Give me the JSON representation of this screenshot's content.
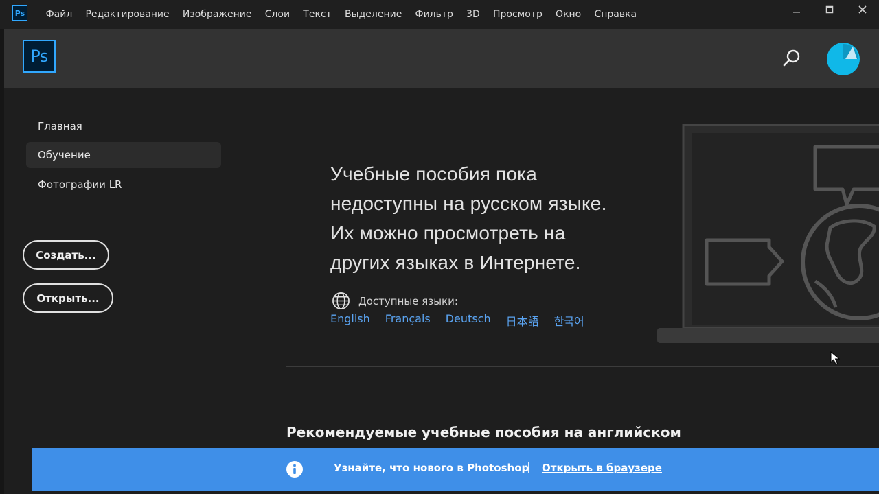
{
  "menubar": {
    "app_icon": "Ps",
    "items": [
      "Файл",
      "Редактирование",
      "Изображение",
      "Слои",
      "Текст",
      "Выделение",
      "Фильтр",
      "3D",
      "Просмотр",
      "Окно",
      "Справка"
    ],
    "controls": [
      "minimize-icon",
      "maximize-icon",
      "close-icon"
    ]
  },
  "header": {
    "logo": "Ps",
    "search_icon": "search-icon",
    "avatar_icon": "user-avatar",
    "accent_color": "#31a8ff"
  },
  "sidebar": {
    "items": [
      {
        "label": "Главная",
        "active": false
      },
      {
        "label": "Обучение",
        "active": true
      },
      {
        "label": "Фотографии LR",
        "active": false
      }
    ],
    "create_label": "Создать...",
    "open_label": "Открыть..."
  },
  "main": {
    "headline_lines": [
      "Учебные пособия пока",
      "недоступны на русском языке.",
      "Их можно просмотреть на",
      "других языках в Интернете."
    ],
    "languages_label": "Доступные языки:",
    "languages_icon": "globe-icon",
    "languages": [
      "English",
      "Français",
      "Deutsch",
      "日本語",
      "한국어"
    ],
    "link_color": "#5aa3f0",
    "section_title": "Рекомендуемые учебные пособия на английском"
  },
  "banner": {
    "icon": "info-icon",
    "text": "Узнайте, что нового в Photoshop",
    "separator": "|",
    "link": "Открыть в браузере",
    "color": "#3f8fe8"
  }
}
